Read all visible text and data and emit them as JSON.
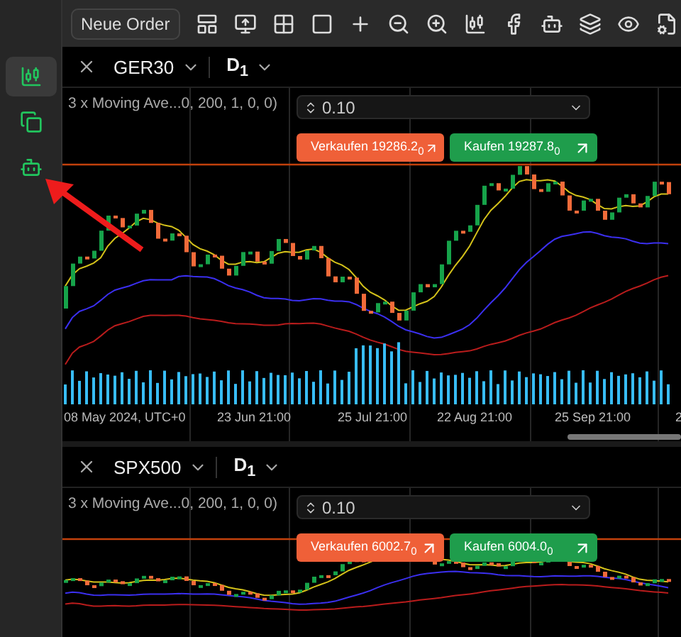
{
  "toolbar": {
    "new_order": "Neue Order"
  },
  "sidebar": {
    "items": [
      {
        "selected": true
      },
      {
        "selected": false
      },
      {
        "selected": false
      }
    ]
  },
  "charts": [
    {
      "symbol": "GER30",
      "timeframe": "D$_{1}$",
      "indicator": "3 x Moving Ave...0, 200, 1, 0, 0)",
      "quantity": "0.10",
      "sell": "Verkaufen 19286.2$_{0}$",
      "buy": "Kaufen 19287.8$_{0}$",
      "x_labels": [
        "08 May 2024, UTC+0",
        "23 Jun 21:00",
        "25 Jul 21:00",
        "22 Aug 21:00",
        "25 Sep 21:00",
        "2"
      ]
    },
    {
      "symbol": "SPX500",
      "timeframe": "D$_{1}$",
      "indicator": "3 x Moving Ave...0, 200, 1, 0, 0)",
      "quantity": "0.10",
      "sell": "Verkaufen 6002.7$_{0}$",
      "buy": "Kaufen 6004.0$_{0}$"
    }
  ]
}
